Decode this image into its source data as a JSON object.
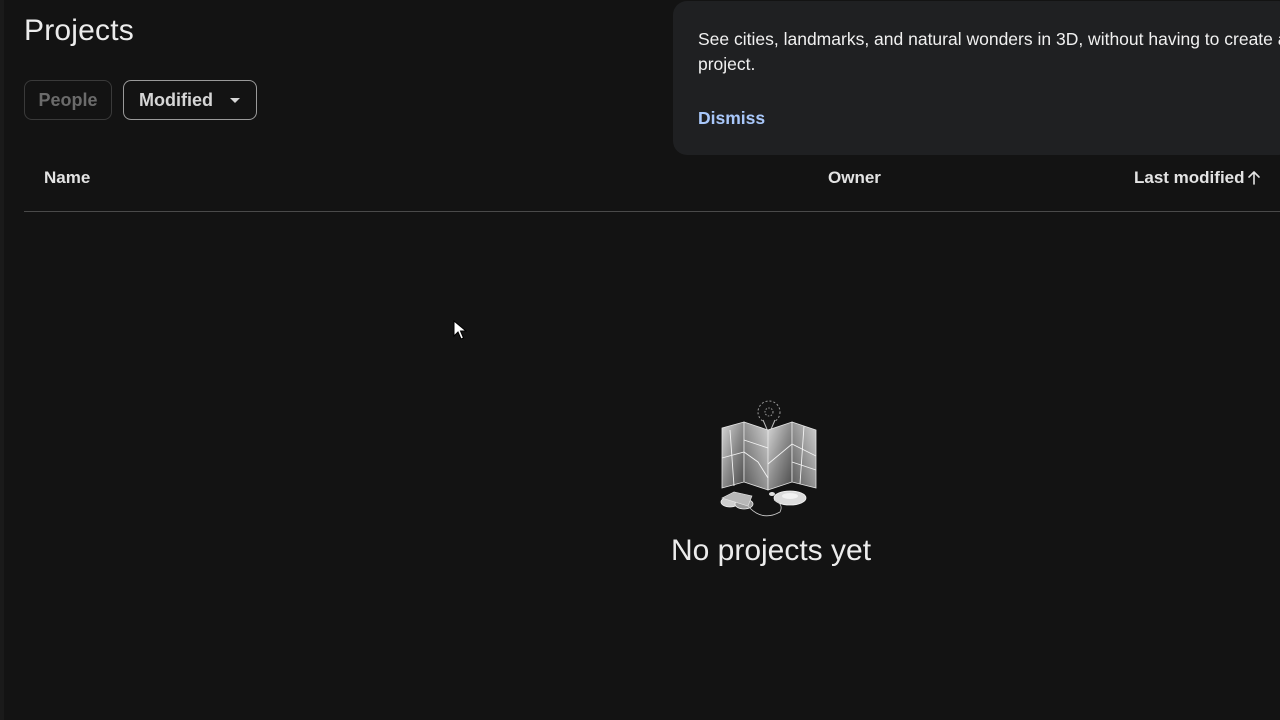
{
  "header": {
    "title": "Projects"
  },
  "filters": {
    "people_label": "People",
    "modified_label": "Modified"
  },
  "table": {
    "columns": [
      "Name",
      "Owner",
      "Last modified"
    ],
    "sort_direction": "ascending",
    "rows": []
  },
  "banner": {
    "text": "See cities, landmarks, and natural wonders in 3D, without having to create a project.",
    "dismiss_label": "Dismiss"
  },
  "empty_state": {
    "message": "No projects yet",
    "illustration": "map-with-pin-and-binoculars-icon"
  },
  "colors": {
    "background": "#131313",
    "banner_background": "#1f2022",
    "link": "#a8c7fa",
    "text": "#e3e3e3",
    "muted_text": "#6b6b6b"
  }
}
